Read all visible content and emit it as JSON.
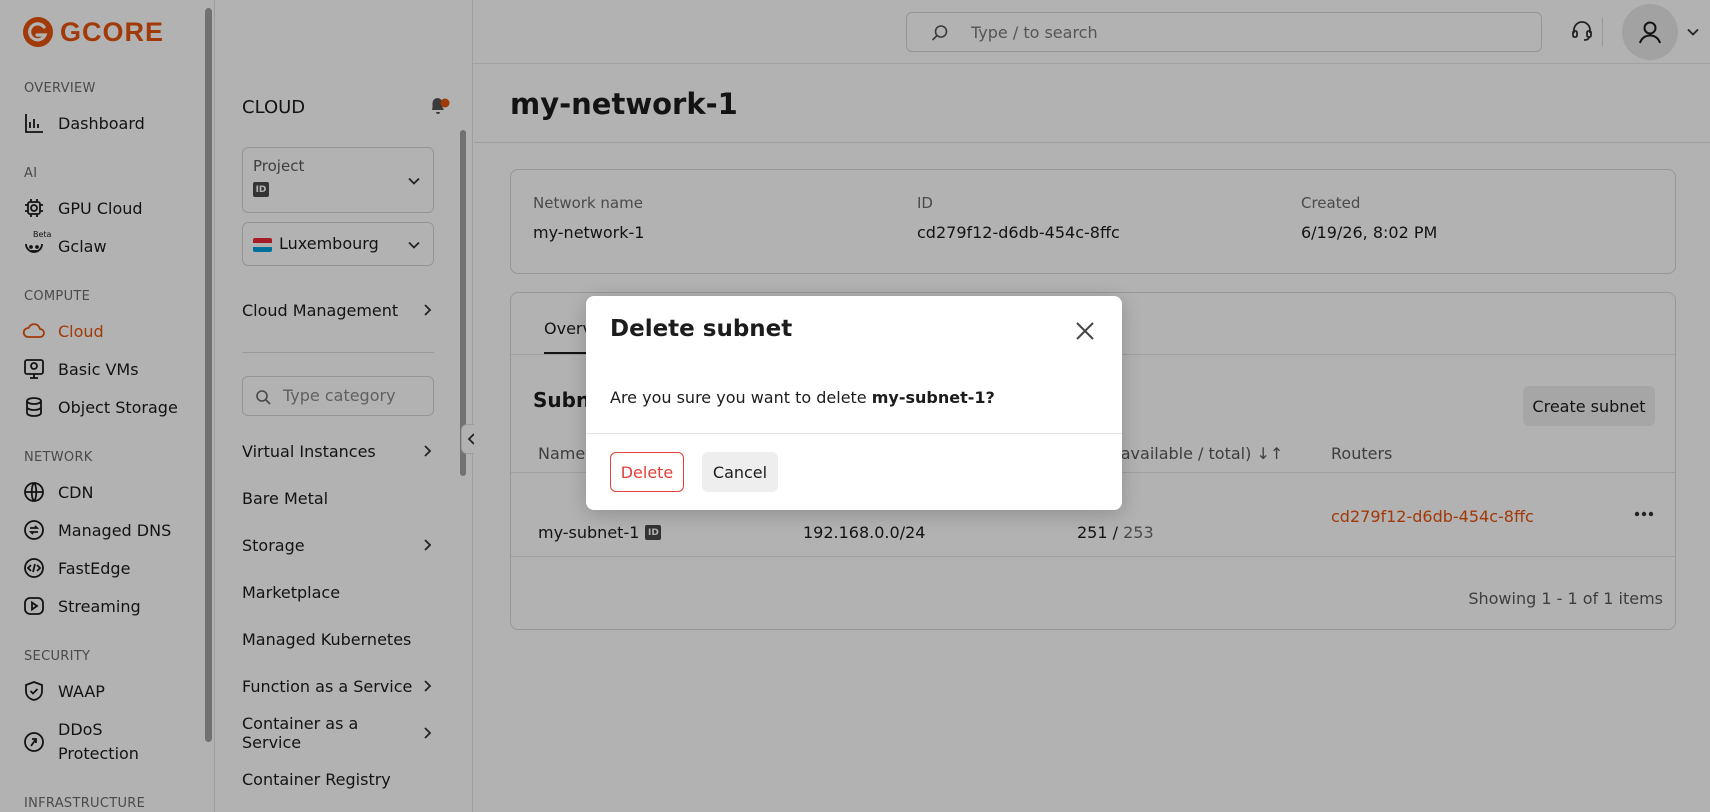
{
  "brand": {
    "name": "GCORE",
    "accent": "#e8520c"
  },
  "leftnav": {
    "sections": [
      {
        "label": "OVERVIEW"
      },
      {
        "label": "AI"
      },
      {
        "label": "COMPUTE"
      },
      {
        "label": "NETWORK"
      },
      {
        "label": "SECURITY"
      },
      {
        "label": "INFRASTRUCTURE"
      }
    ],
    "items": [
      {
        "label": "Dashboard",
        "icon": "bar-chart-icon"
      },
      {
        "label": "GPU Cloud",
        "icon": "gpu-chip-icon"
      },
      {
        "label": "Gclaw",
        "icon": "robot-icon",
        "badge": "Beta"
      },
      {
        "label": "Cloud",
        "icon": "cloud-icon",
        "active": true
      },
      {
        "label": "Basic VMs",
        "icon": "monitor-icon"
      },
      {
        "label": "Object Storage",
        "icon": "database-icon"
      },
      {
        "label": "CDN",
        "icon": "globe-icon"
      },
      {
        "label": "Managed DNS",
        "icon": "dns-icon"
      },
      {
        "label": "FastEdge",
        "icon": "code-icon"
      },
      {
        "label": "Streaming",
        "icon": "play-icon"
      },
      {
        "label": "WAAP",
        "icon": "shield-check-icon"
      },
      {
        "label": "DDoS",
        "label2": "Protection",
        "icon": "ddos-icon"
      }
    ]
  },
  "subnav": {
    "title": "CLOUD",
    "project_label": "Project",
    "project_id_badge": "ID",
    "region": "Luxembourg",
    "cloud_management": "Cloud Management",
    "category_placeholder": "Type category",
    "items": [
      {
        "label": "Virtual Instances",
        "arrow": true
      },
      {
        "label": "Bare Metal",
        "arrow": false
      },
      {
        "label": "Storage",
        "arrow": true
      },
      {
        "label": "Marketplace",
        "arrow": false
      },
      {
        "label": "Managed Kubernetes",
        "arrow": false
      },
      {
        "label": "Function as a Service",
        "arrow": true
      },
      {
        "label": "Container as a Service",
        "arrow": true
      },
      {
        "label": "Container Registry",
        "arrow": false
      }
    ]
  },
  "header": {
    "search_placeholder": "Type / to search"
  },
  "main": {
    "title": "my-network-1",
    "info": {
      "network_name_label": "Network name",
      "network_name_value": "my-network-1",
      "id_label": "ID",
      "id_value": "cd279f12-d6db-454c-8ffc",
      "created_label": "Created",
      "created_value": "6/19/26, 8:02 PM"
    },
    "tab_partial": "Overv",
    "section_partial": "Subne",
    "create_button": "Create subnet",
    "columns": {
      "name_partial": "Name",
      "ip_count_partial": "nt (available / total) ↓↑",
      "routers": "Routers"
    },
    "row": {
      "name": "my-subnet-1",
      "id_badge": "ID",
      "cidr": "192.168.0.0/24",
      "available": "251",
      "separator": " / ",
      "total": "253",
      "router": "cd279f12-d6db-454c-8ffc"
    },
    "pagination": "Showing 1 - 1 of 1 items"
  },
  "modal": {
    "title": "Delete subnet",
    "body_prefix": "Are you sure you want to delete ",
    "body_target": "my-subnet-1?",
    "delete_label": "Delete",
    "cancel_label": "Cancel"
  }
}
